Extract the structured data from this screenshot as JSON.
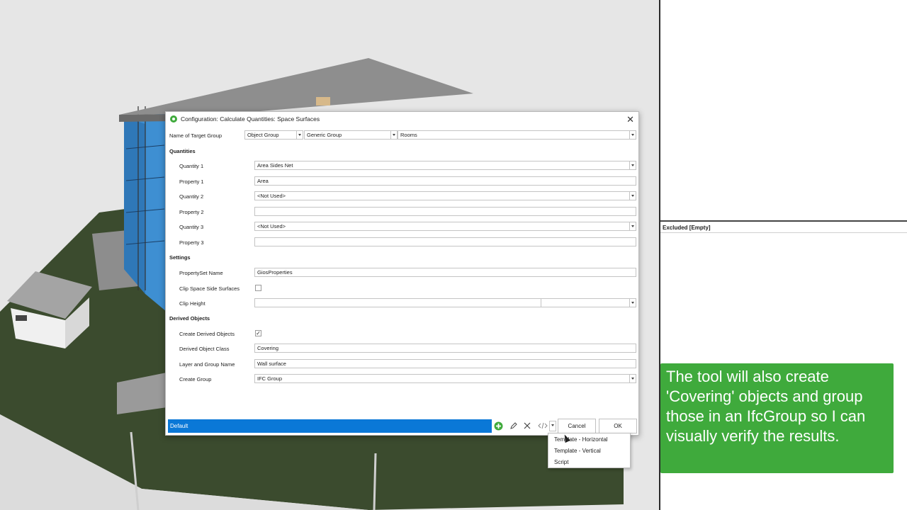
{
  "dialog": {
    "title": "Configuration: Calculate Quantities: Space Surfaces",
    "close_glyph": "✕",
    "target_group": {
      "label": "Name of Target Group",
      "type_value": "Object Group",
      "group_value": "Generic Group",
      "name_value": "Rooms"
    },
    "quantities": {
      "heading": "Quantities",
      "rows": [
        {
          "quantity_label": "Quantity 1",
          "quantity_value": "Area Sides Net",
          "property_label": "Property 1",
          "property_value": "Area"
        },
        {
          "quantity_label": "Quantity 2",
          "quantity_value": "<Not Used>",
          "property_label": "Property 2",
          "property_value": ""
        },
        {
          "quantity_label": "Quantity 3",
          "quantity_value": "<Not Used>",
          "property_label": "Property 3",
          "property_value": ""
        }
      ]
    },
    "settings": {
      "heading": "Settings",
      "propertyset_label": "PropertySet Name",
      "propertyset_value": "GiosProperties",
      "clip_label": "Clip Space Side Surfaces",
      "clip_checked": false,
      "clip_height_label": "Clip Height",
      "clip_height_value": "",
      "clip_height_unit": ""
    },
    "derived": {
      "heading": "Derived Objects",
      "create_label": "Create Derived Objects",
      "create_checked": true,
      "check_glyph": "✓",
      "class_label": "Derived Object Class",
      "class_value": "Covering",
      "layer_label": "Layer and Group Name",
      "layer_value": "Wall surface",
      "group_label": "Create Group",
      "group_value": "IFC Group"
    },
    "footer": {
      "template_value": "Default",
      "cancel_label": "Cancel",
      "ok_label": "OK"
    }
  },
  "template_menu": {
    "items": [
      "Template - Horizontal",
      "Template - Vertical",
      "Script"
    ]
  },
  "right_panel": {
    "excluded_label": "Excluded [Empty]"
  },
  "callout": {
    "text": "The tool will also create 'Covering' objects and group those in an IfcGroup so I can visually verify the results.",
    "color": "#3faa3c"
  }
}
